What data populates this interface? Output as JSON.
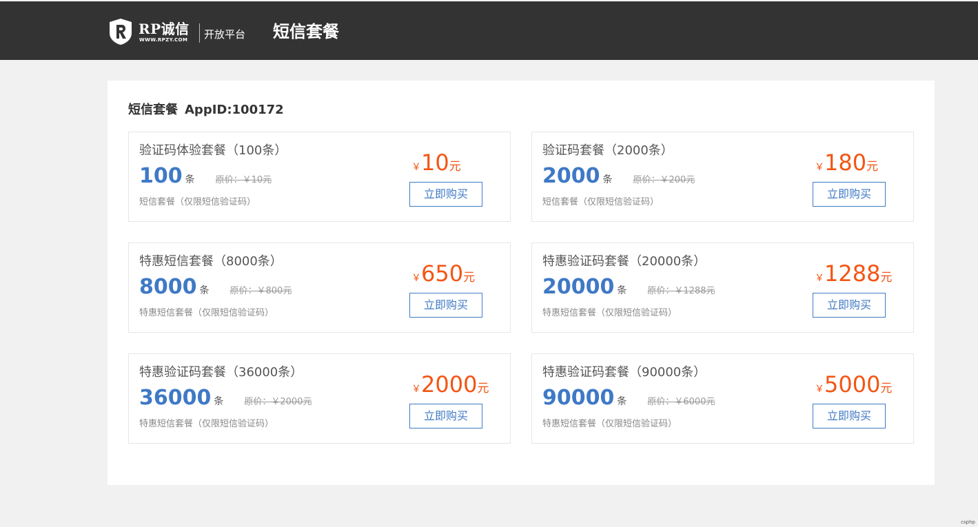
{
  "header": {
    "brand": "RP诚信",
    "brand_url": "WWW.RPZY.COM",
    "platform": "开放平台",
    "title": "短信套餐"
  },
  "panel": {
    "heading": "短信套餐",
    "appid": "AppID:100172"
  },
  "packages": [
    {
      "name": "验证码体验套餐（100条）",
      "count": "100",
      "unit": "条",
      "orig": "原价：￥10元",
      "desc": "短信套餐（仅限短信验证码）",
      "currency": "￥",
      "price": "10",
      "price_unit": "元",
      "buy": "立即购买"
    },
    {
      "name": "验证码套餐（2000条）",
      "count": "2000",
      "unit": "条",
      "orig": "原价：￥200元",
      "desc": "短信套餐（仅限短信验证码）",
      "currency": "￥",
      "price": "180",
      "price_unit": "元",
      "buy": "立即购买"
    },
    {
      "name": "特惠短信套餐（8000条）",
      "count": "8000",
      "unit": "条",
      "orig": "原价：￥800元",
      "desc": "特惠短信套餐（仅限短信验证码）",
      "currency": "￥",
      "price": "650",
      "price_unit": "元",
      "buy": "立即购买"
    },
    {
      "name": "特惠验证码套餐（20000条）",
      "count": "20000",
      "unit": "条",
      "orig": "原价：￥1288元",
      "desc": "特惠短信套餐（仅限短信验证码）",
      "currency": "￥",
      "price": "1288",
      "price_unit": "元",
      "buy": "立即购买"
    },
    {
      "name": "特惠验证码套餐（36000条）",
      "count": "36000",
      "unit": "条",
      "orig": "原价：￥2000元",
      "desc": "特惠短信套餐（仅限短信验证码）",
      "currency": "￥",
      "price": "2000",
      "price_unit": "元",
      "buy": "立即购买"
    },
    {
      "name": "特惠验证码套餐（90000条）",
      "count": "90000",
      "unit": "条",
      "orig": "原价：￥6000元",
      "desc": "特惠短信套餐（仅限短信验证码）",
      "currency": "￥",
      "price": "5000",
      "price_unit": "元",
      "buy": "立即购买"
    }
  ],
  "footer_mark": "csphp",
  "colors": {
    "header_bg": "#333333",
    "accent_blue": "#3f79c6",
    "price_orange": "#f35514",
    "page_bg": "#f1f1f1"
  }
}
